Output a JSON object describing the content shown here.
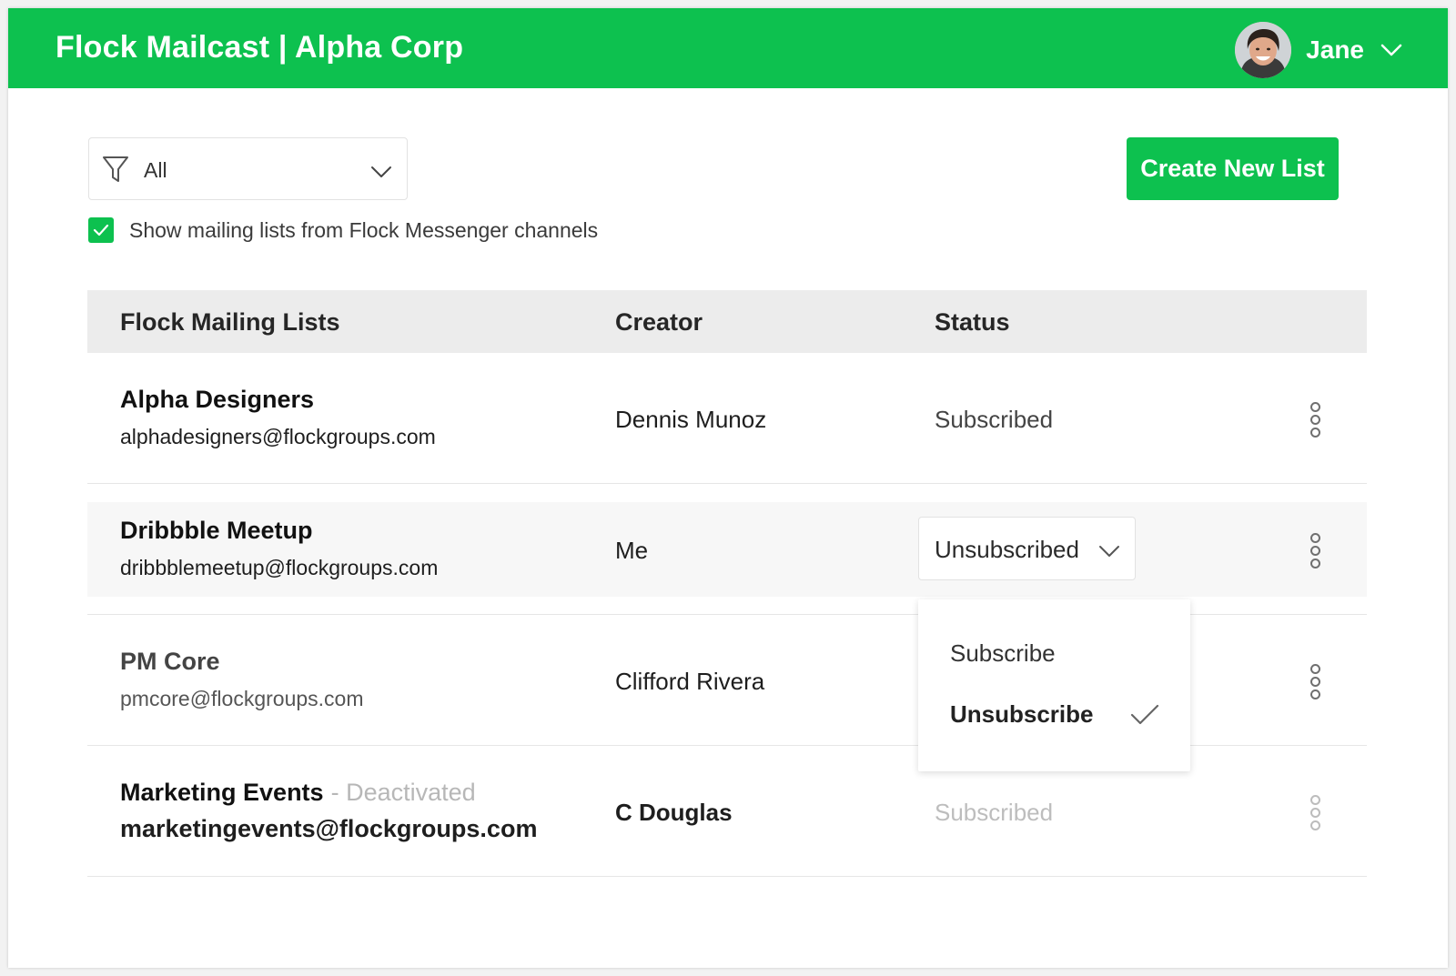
{
  "header": {
    "app_title": "Flock Mailcast | Alpha Corp",
    "user_name": "Jane",
    "brand_color": "#0dc14f"
  },
  "filter": {
    "selected": "All"
  },
  "channels_toggle": {
    "checked": true,
    "label": "Show mailing lists from Flock Messenger channels"
  },
  "toolbar": {
    "create_label": "Create New List"
  },
  "table": {
    "columns": [
      "Flock Mailing Lists",
      "Creator",
      "Status"
    ],
    "rows": [
      {
        "name": "Alpha Designers",
        "email": "alphadesigners@flockgroups.com",
        "creator": "Dennis Munoz",
        "status": "Subscribed"
      },
      {
        "name": "Dribbble Meetup",
        "email": "dribbblemeetup@flockgroups.com",
        "creator": "Me",
        "status": "Unsubscribed"
      },
      {
        "name": "PM Core",
        "email": "pmcore@flockgroups.com",
        "creator": "Clifford Rivera",
        "status": ""
      },
      {
        "name": "Marketing Events",
        "tag": "- Deactivated",
        "email": "marketingevents@flockgroups.com",
        "creator": "C Douglas",
        "status": "Subscribed"
      }
    ]
  },
  "status_menu": {
    "options": [
      "Subscribe",
      "Unsubscribe"
    ],
    "selected": "Unsubscribe"
  }
}
